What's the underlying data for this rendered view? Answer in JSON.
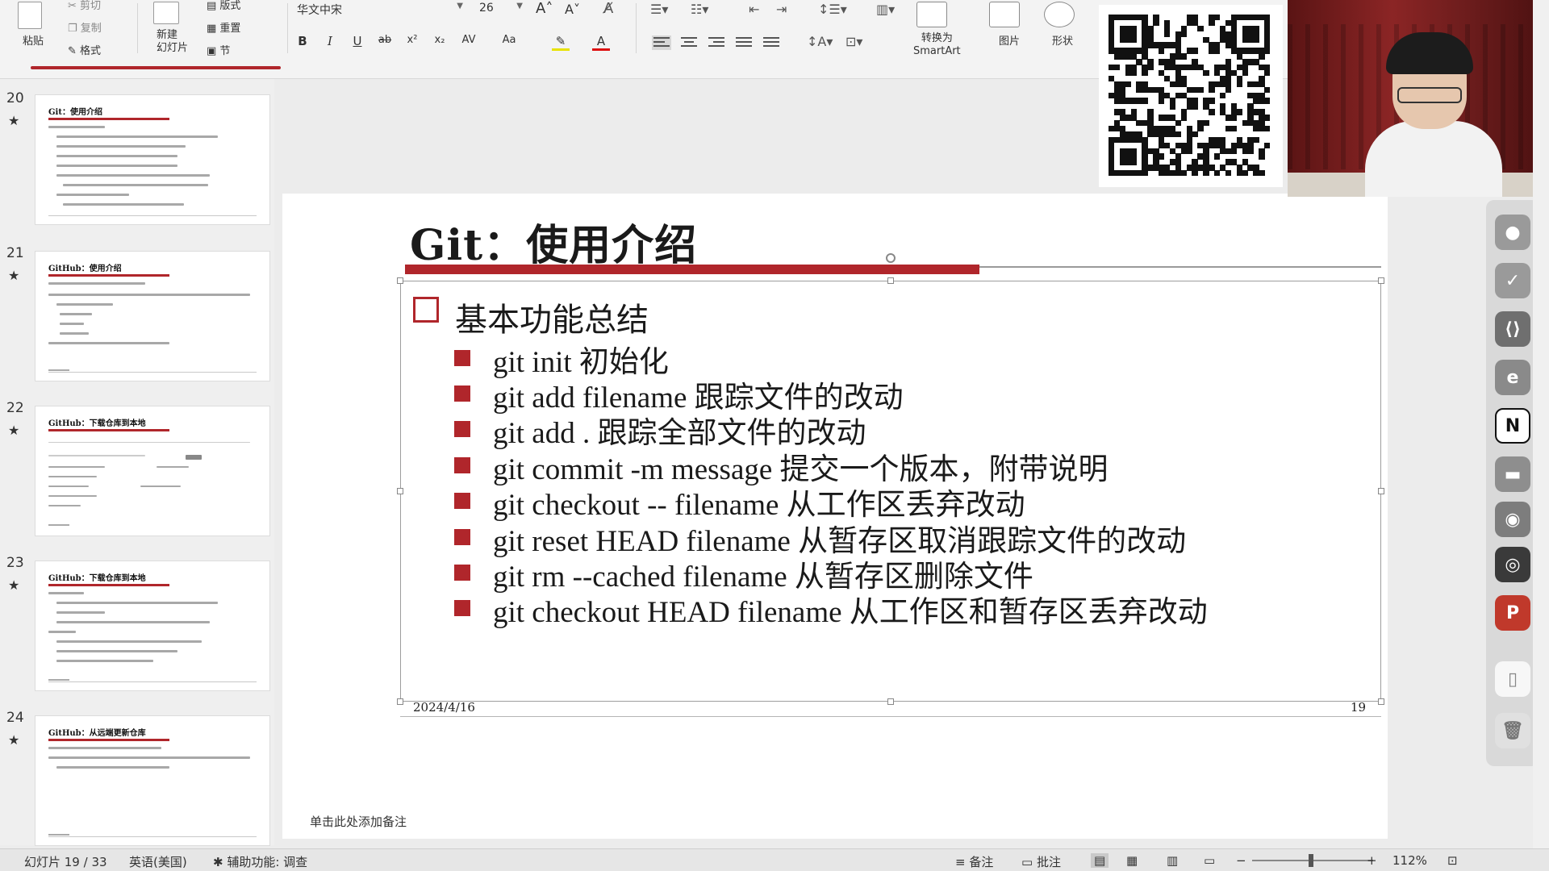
{
  "ribbon": {
    "paste": "粘贴",
    "cut": "剪切",
    "copy": "复制",
    "format_painter": "格式",
    "new_slide": "新建\n幻灯片",
    "layout": "版式",
    "reset": "重置",
    "section": "节",
    "font_name": "华文中宋",
    "font_size": "26",
    "bold": "B",
    "italic": "I",
    "underline": "U",
    "strike": "ab",
    "superscript": "x²",
    "subscript": "x₂",
    "char_spacing": "AV",
    "change_case": "Aa",
    "convert_smartart": "转换为\nSmartArt",
    "picture": "图片",
    "shape": "形状"
  },
  "thumbnails": [
    {
      "num": "20",
      "title": "Git：使用介绍"
    },
    {
      "num": "21",
      "title": "GitHub：使用介绍"
    },
    {
      "num": "22",
      "title": "GitHub：下载仓库到本地"
    },
    {
      "num": "23",
      "title": "GitHub：下载仓库到本地"
    },
    {
      "num": "24",
      "title": "GitHub：从远端更新仓库"
    }
  ],
  "slide": {
    "title": "Git：使用介绍",
    "section": "基本功能总结",
    "bullets": [
      "git init 初始化",
      "git add filename 跟踪文件的改动",
      "git add . 跟踪全部文件的改动",
      "git commit -m message 提交一个版本，附带说明",
      "git checkout -- filename 从工作区丢弃改动",
      "git reset HEAD filename 从暂存区取消跟踪文件的改动",
      "git rm --cached filename 从暂存区删除文件",
      "git checkout HEAD filename 从工作区和暂存区丢弃改动"
    ],
    "date": "2024/4/16",
    "page": "19"
  },
  "notes_placeholder": "单击此处添加备注",
  "status": {
    "slide_count": "幻灯片 19 / 33",
    "language": "英语(美国)",
    "accessibility": "辅助功能: 调查",
    "notes": "备注",
    "comments": "批注",
    "zoom": "112%"
  },
  "colors": {
    "accent_red": "#b0262b"
  }
}
